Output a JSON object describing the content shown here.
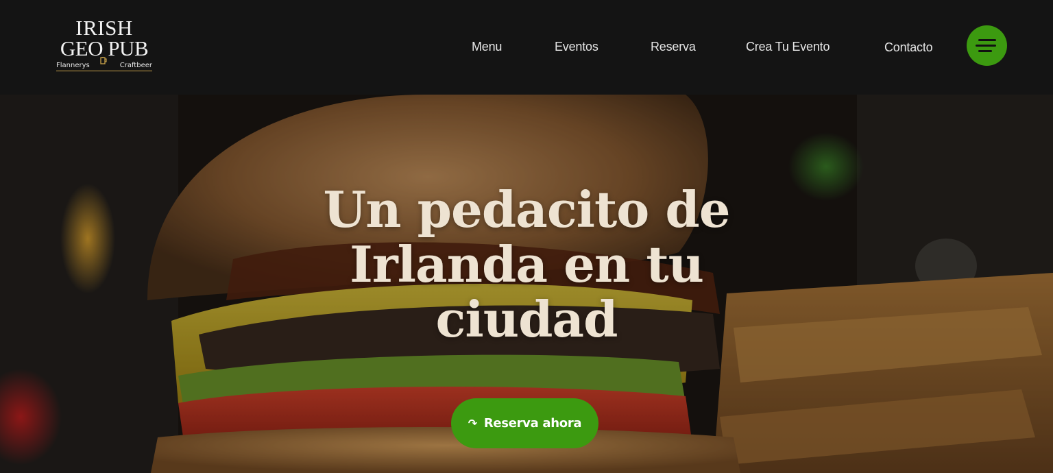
{
  "brand": {
    "line1": "IRISH",
    "line2": "GEO PUB",
    "sub_left": "Flannerys",
    "sub_right": "Craftbeer"
  },
  "nav": {
    "items": [
      {
        "label": "Menu"
      },
      {
        "label": "Eventos"
      },
      {
        "label": "Reserva"
      },
      {
        "label": "Crea Tu Evento"
      },
      {
        "label": "Contacto"
      }
    ]
  },
  "hero": {
    "headline_line1": "Un pedacito de",
    "headline_line2": "Irlanda en tu",
    "headline_line3": "ciudad",
    "cta_label": "Reserva ahora"
  },
  "colors": {
    "accent_green": "#3c9a10",
    "header_bg": "#141414",
    "headline_text": "#eee3d2"
  },
  "icons": {
    "menu": "hamburger-menu-icon",
    "cta": "redo-arrow-icon",
    "logo_mark": "beer-mug-icon"
  }
}
